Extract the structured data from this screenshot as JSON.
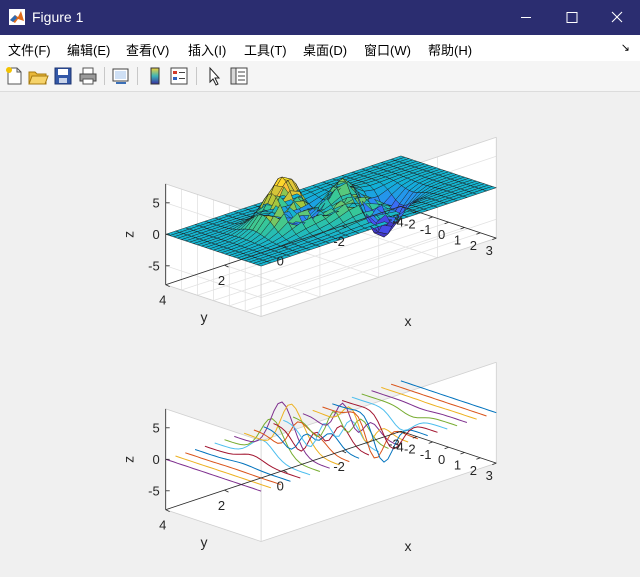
{
  "window": {
    "title": "Figure 1"
  },
  "menu": [
    "文件(F)",
    "编辑(E)",
    "查看(V)",
    "插入(I)",
    "工具(T)",
    "桌面(D)",
    "窗口(W)",
    "帮助(H)"
  ],
  "toolbar": [
    "new-figure-icon",
    "open-icon",
    "save-icon",
    "print-icon",
    "link-plot-icon",
    "colorbar-icon",
    "legend-icon",
    "pointer-icon",
    "property-inspector-icon"
  ],
  "colors": {
    "titlebar": "#2b2d70",
    "axes_bg": "#ffffff",
    "canvas_bg": "#f0f0f0"
  },
  "chart_data": [
    {
      "type": "surface",
      "function": "peaks",
      "grid_points": 25,
      "x_range": [
        -3,
        3
      ],
      "y_range": [
        -4,
        4
      ],
      "z_range": [
        -8,
        8
      ],
      "xlabel": "x",
      "ylabel": "y",
      "zlabel": "z",
      "xticks": [
        "-3",
        "-2",
        "-1",
        "0",
        "1",
        "2",
        "3"
      ],
      "yticks": [
        "4",
        "2",
        "0",
        "-2",
        "-4"
      ],
      "zticks": [
        "5",
        "0",
        "-5"
      ],
      "colormap": "parula",
      "grid": true
    },
    {
      "type": "line",
      "plot": "ribbon lines of peaks (lines along x for each y)",
      "function": "peaks",
      "line_count": 25,
      "x_range": [
        -3,
        3
      ],
      "y_range": [
        -4,
        4
      ],
      "z_range": [
        -8,
        8
      ],
      "xlabel": "x",
      "ylabel": "y",
      "zlabel": "z",
      "xticks": [
        "-3",
        "-2",
        "-1",
        "0",
        "1",
        "2",
        "3"
      ],
      "yticks": [
        "4",
        "2",
        "0",
        "-2",
        "-4"
      ],
      "zticks": [
        "5",
        "0",
        "-5"
      ],
      "line_colors": [
        "#0072bd",
        "#d95319",
        "#edb120",
        "#7e2f8e",
        "#77ac30",
        "#4dbeee",
        "#a2142f"
      ],
      "grid": false
    }
  ]
}
